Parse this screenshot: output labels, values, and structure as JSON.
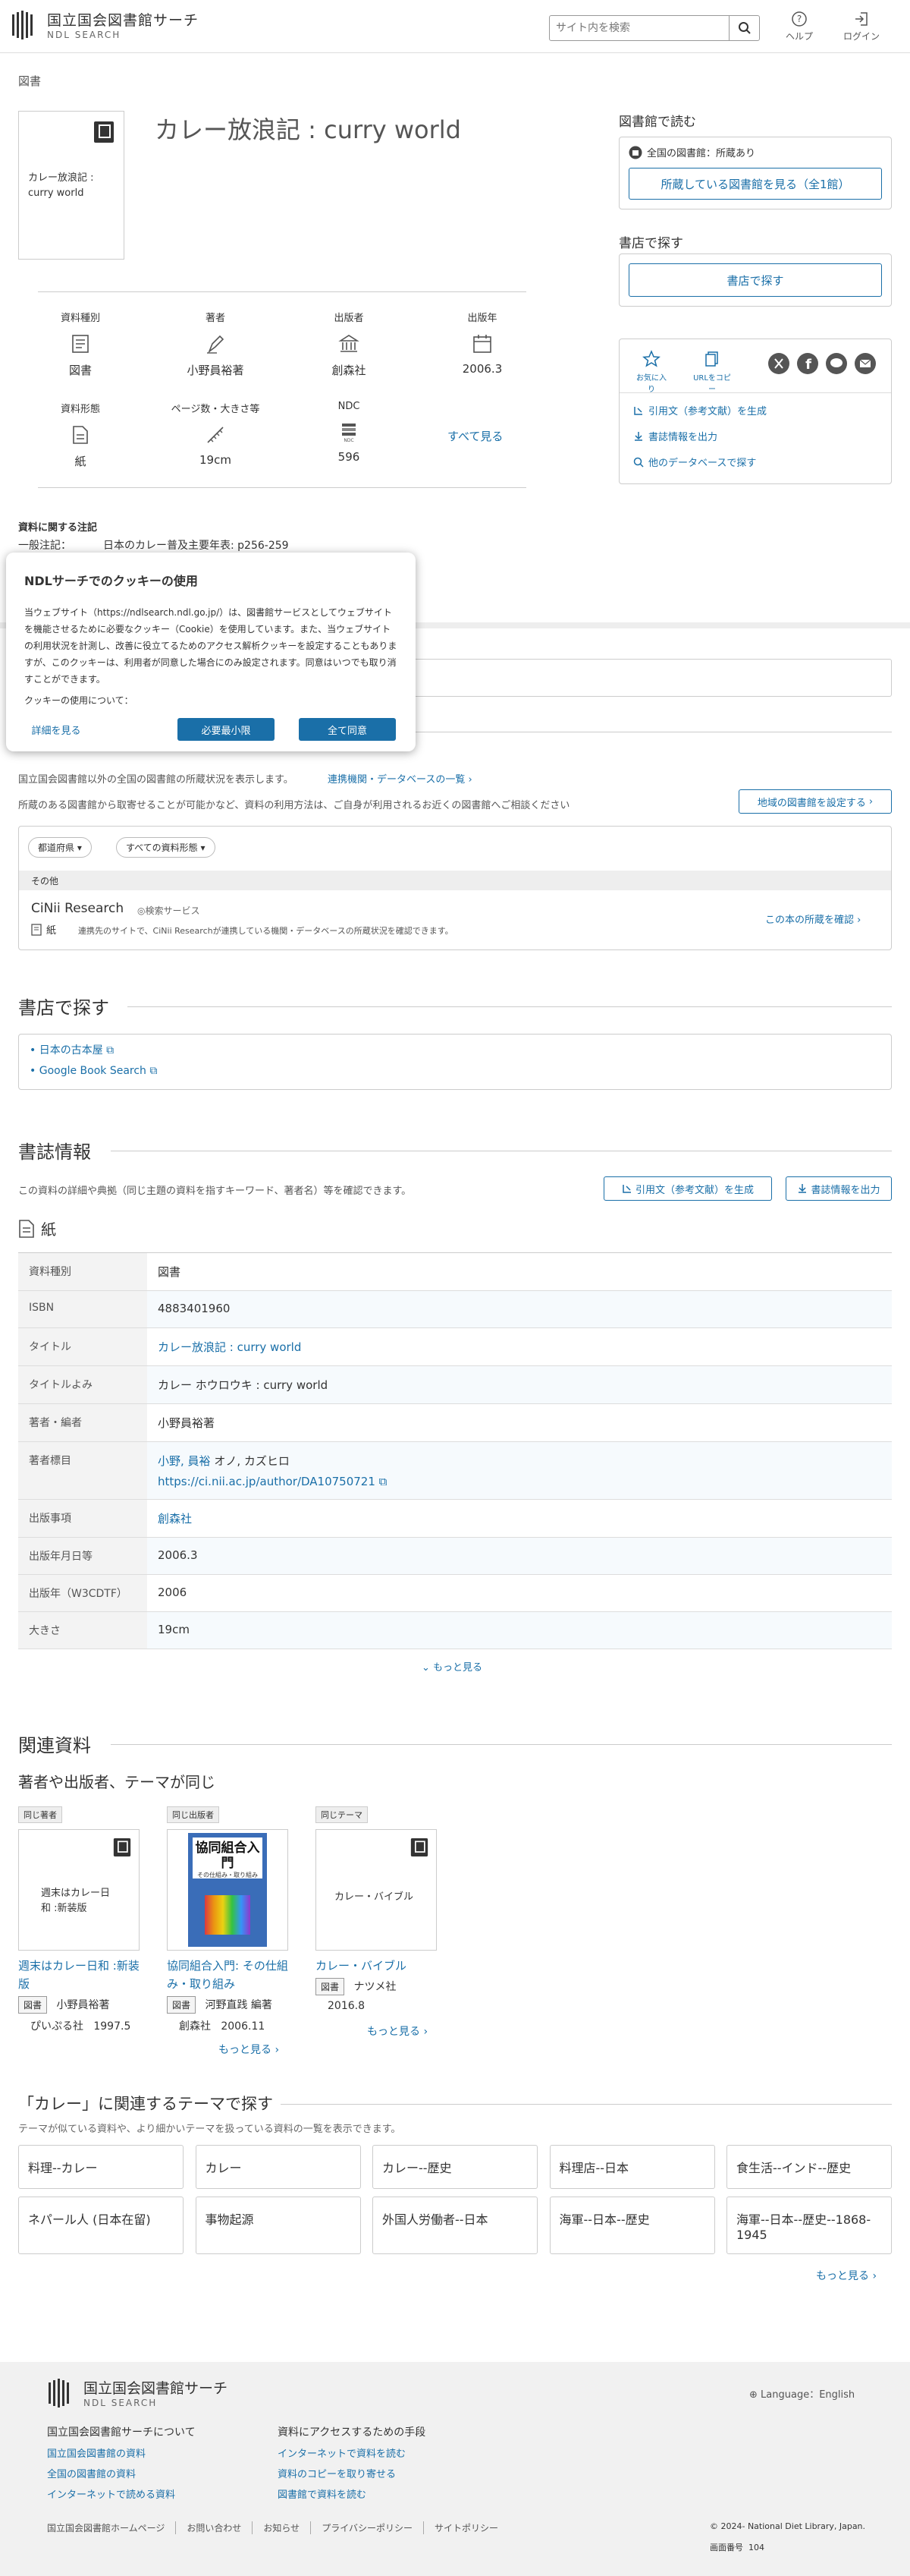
{
  "header": {
    "logo_ja": "国立国会図書館サーチ",
    "logo_en": "NDL SEARCH",
    "search_placeholder": "サイト内を検索",
    "help": "ヘルプ",
    "login": "ログイン"
  },
  "breadcrumb": "図書",
  "item": {
    "title": "カレー放浪記 : curry world",
    "cover_title": "カレー放浪記 : curry world",
    "facets": [
      {
        "label": "資料種別",
        "value": "図書",
        "icon": "book-type-icon"
      },
      {
        "label": "著者",
        "value": "小野員裕著",
        "icon": "pen-icon"
      },
      {
        "label": "出版者",
        "value": "創森社",
        "icon": "building-icon"
      },
      {
        "label": "出版年",
        "value": "2006.3",
        "icon": "calendar-icon"
      },
      {
        "label": "資料形態",
        "value": "紙",
        "icon": "paper-icon"
      },
      {
        "label": "ページ数・大きさ等",
        "value": "19cm",
        "icon": "ruler-icon"
      },
      {
        "label": "NDC",
        "value": "596",
        "icon": "ndc-icon"
      }
    ],
    "see_all": "すべて見る",
    "notes_heading": "資料に関する注記",
    "note_label": "一般注記：",
    "note_value": "日本のカレー普及主要年表: p256-259"
  },
  "right_panel": {
    "read_heading": "図書館で読む",
    "nationwide": "全国の図書館：所蔵あり",
    "holdings_button": "所蔵している図書館を見る（全1館）",
    "shop_heading": "書店で探す",
    "shop_button": "書店で探す",
    "favorite": "お気に入り",
    "copy_url": "URLをコピー",
    "cite": "引用文（参考文献）を生成",
    "export": "書誌情報を出力",
    "other_db": "他のデータベースで探す"
  },
  "cookie": {
    "title": "NDLサーチでのクッキーの使用",
    "body": "当ウェブサイト（https://ndlsearch.ndl.go.jp/）は、図書館サービスとしてウェブサイトを機能させるために必要なクッキー（Cookie）を使用しています。また、当ウェブサイトの利用状況を計測し、改善に役立てるためのアクセス解析クッキーを設定することもありますが、このクッキーは、利用者が同意した場合にのみ設定されます。同意はいつでも取り消すことができます。",
    "usage_label": "クッキーの使用について：",
    "details": "詳細を見る",
    "minimum": "必要最小限",
    "accept_all": "全て同意"
  },
  "libraries": {
    "intro": "国立国会図書館以外の全国の図書館の所蔵状況を表示します。",
    "partner_link": "連携機関・データベースの一覧",
    "note": "所蔵のある図書館から取寄せることが可能かなど、資料の利用方法は、ご自身が利用されるお近くの図書館へご相談ください",
    "region_button": "地域の図書館を設定する",
    "filter_pref": "都道府県",
    "filter_type": "すべての資料形態",
    "group_label": "その他",
    "cinii_name": "CiNii Research",
    "cinii_service": "検索サービス",
    "cinii_type": "紙",
    "cinii_desc": "連携先のサイトで、CiNii Researchが連携している機関・データベースの所蔵状況を確認できます。",
    "cinii_link": "この本の所蔵を確認"
  },
  "bookstores": {
    "heading": "書店で探す",
    "links": [
      "日本の古本屋",
      "Google Book Search"
    ]
  },
  "bib": {
    "heading": "書誌情報",
    "desc": "この資料の詳細や典拠（同じ主題の資料を指すキーワード、著者名）等を確認できます。",
    "cite": "引用文（参考文献）を生成",
    "export": "書誌情報を出力",
    "format": "紙",
    "rows": [
      {
        "k": "資料種別",
        "v": "図書"
      },
      {
        "k": "ISBN",
        "v": "4883401960"
      },
      {
        "k": "タイトル",
        "v": "カレー放浪記 : curry world"
      },
      {
        "k": "タイトルよみ",
        "v": "カレー ホウロウキ : curry world"
      },
      {
        "k": "著者・編者",
        "v": "小野員裕著"
      },
      {
        "k": "著者標目",
        "v": "小野, 員裕",
        "v2": "オノ, カズヒロ",
        "v3": "https://ci.nii.ac.jp/author/DA10750721"
      },
      {
        "k": "出版事項",
        "v": "創森社"
      },
      {
        "k": "出版年月日等",
        "v": "2006.3"
      },
      {
        "k": "出版年（W3CDTF）",
        "v": "2006"
      },
      {
        "k": "大きさ",
        "v": "19cm"
      }
    ],
    "more": "もっと見る"
  },
  "related": {
    "heading": "関連資料",
    "subheading": "著者や出版者、テーマが同じ",
    "cards": [
      {
        "badge": "同じ著者",
        "cover": "週末はカレー日和 :新装版",
        "title": "週末はカレー日和 :新装版",
        "type": "図書",
        "author": "小野員裕著",
        "publisher": "ぴいぷる社",
        "year": "1997.5"
      },
      {
        "badge": "同じ出版者",
        "cover_title": "協同組合入門",
        "cover_sub": "その仕組み・取り組み",
        "title": "協同組合入門: その仕組み・取り組み",
        "type": "図書",
        "author": "河野直践 編著",
        "publisher": "創森社",
        "year": "2006.11"
      },
      {
        "badge": "同じテーマ",
        "cover": "カレー・バイブル",
        "title": "カレー・バイブル",
        "type": "図書",
        "author": "ナツメ社",
        "publisher": "",
        "year": "2016.8"
      }
    ],
    "more": "もっと見る"
  },
  "themes": {
    "heading": "「カレー」に関連するテーマで探す",
    "desc": "テーマが似ている資料や、より細かいテーマを扱っている資料の一覧を表示できます。",
    "tags": [
      "料理--カレー",
      "カレー",
      "カレー--歴史",
      "料理店--日本",
      "食生活--インド--歴史",
      "ネパール人 (日本在留)",
      "事物起源",
      "外国人労働者--日本",
      "海軍--日本--歴史",
      "海軍--日本--歴史--1868-1945"
    ],
    "more": "もっと見る"
  },
  "footer": {
    "logo_ja": "国立国会図書館サーチ",
    "logo_en": "NDL SEARCH",
    "language": "Language：English",
    "about_heading": "国立国会図書館サーチについて",
    "about_links": [
      "国立国会図書館の資料",
      "全国の図書館の資料",
      "インターネットで読める資料"
    ],
    "access_heading": "資料にアクセスするための手段",
    "access_links": [
      "インターネットで資料を読む",
      "資料のコピーを取り寄せる",
      "図書館で資料を読む"
    ],
    "bottom_links": [
      "国立国会図書館ホームページ",
      "お問い合わせ",
      "お知らせ",
      "プライバシーポリシー",
      "サイトポリシー"
    ],
    "copyright": "© 2024- National Diet Library, Japan.",
    "screen_label": "画面番号",
    "screen_no": "104"
  }
}
